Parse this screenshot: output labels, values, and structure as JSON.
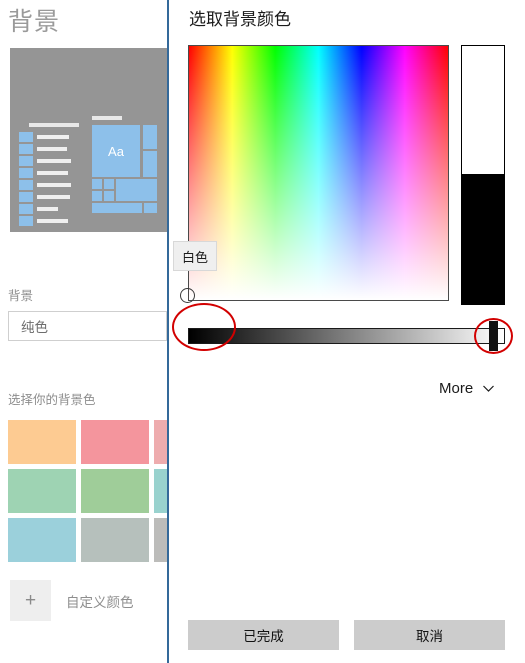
{
  "sidebar": {
    "title": "背景",
    "background_label": "背景",
    "dropdown_value": "纯色",
    "choose_color_label": "选择你的背景色",
    "custom_color_label": "自定义颜色",
    "custom_color_icon": "plus-icon",
    "preview_tile_text": "Aa",
    "swatches": [
      {
        "name": "swatch-orange",
        "color": "#fdcb92"
      },
      {
        "name": "swatch-salmon",
        "color": "#f4959d"
      },
      {
        "name": "swatch-rose",
        "color": "#eeacae"
      },
      {
        "name": "swatch-pink",
        "color": "#e898bd"
      },
      {
        "name": "swatch-mint",
        "color": "#9ed3b3"
      },
      {
        "name": "swatch-green",
        "color": "#9fcd99"
      },
      {
        "name": "swatch-aqua",
        "color": "#99d2ce"
      },
      {
        "name": "swatch-steel-blue",
        "color": "#aecadb"
      },
      {
        "name": "swatch-sky",
        "color": "#9bd0db"
      },
      {
        "name": "swatch-gray-green",
        "color": "#b6c0bc"
      },
      {
        "name": "swatch-gray",
        "color": "#bcbcba"
      },
      {
        "name": "swatch-warm-gray",
        "color": "#cac6bc"
      }
    ]
  },
  "picker": {
    "title": "选取背景颜色",
    "tooltip": "白色",
    "more_label": "More",
    "more_icon": "chevron-down-icon",
    "done_label": "已完成",
    "cancel_label": "取消",
    "preview_top_color": "#ffffff",
    "preview_bottom_color": "#000000",
    "annotation_color": "#d20000"
  }
}
